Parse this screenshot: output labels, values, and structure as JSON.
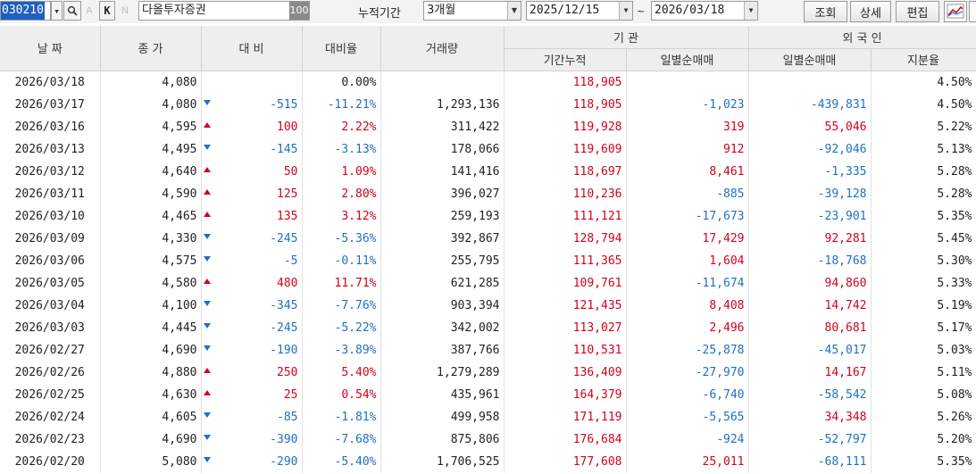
{
  "toolbar": {
    "code": "030210",
    "letter_a": "A",
    "letter_k": "K",
    "letter_n": "N",
    "company": "다올투자증권",
    "badge": "100",
    "period_label": "누적기간",
    "period_value": "3개월",
    "date_from": "2025/12/15",
    "tilde": "~",
    "date_to": "2026/03/18",
    "btn_query": "조회",
    "btn_detail": "상세",
    "btn_edit": "편집"
  },
  "header": {
    "date": "날  짜",
    "close": "종  가",
    "change": "대  비",
    "change_rate": "대비율",
    "volume": "거래량",
    "inst_group": "기    관",
    "inst_cum": "기간누적",
    "inst_daily": "일별순매매",
    "foreign_group": "외 국 인",
    "foreign_daily": "일별순매매",
    "foreign_ratio": "지분율"
  },
  "colors": {
    "up": "#d0021b",
    "down": "#1f6fc5",
    "header_bg": "#eeeeee"
  },
  "rows": [
    {
      "date": "2026/03/18",
      "close": "4,080",
      "dir": "none",
      "change": "",
      "rate": "0.00%",
      "volume": "",
      "inst_cum": "118,905",
      "inst_daily": "",
      "f_daily": "",
      "f_ratio": "4.50%"
    },
    {
      "date": "2026/03/17",
      "close": "4,080",
      "dir": "down",
      "change": "-515",
      "rate": "-11.21%",
      "volume": "1,293,136",
      "inst_cum": "118,905",
      "inst_daily": "-1,023",
      "f_daily": "-439,831",
      "f_ratio": "4.50%"
    },
    {
      "date": "2026/03/16",
      "close": "4,595",
      "dir": "up",
      "change": "100",
      "rate": "2.22%",
      "volume": "311,422",
      "inst_cum": "119,928",
      "inst_daily": "319",
      "f_daily": "55,046",
      "f_ratio": "5.22%"
    },
    {
      "date": "2026/03/13",
      "close": "4,495",
      "dir": "down",
      "change": "-145",
      "rate": "-3.13%",
      "volume": "178,066",
      "inst_cum": "119,609",
      "inst_daily": "912",
      "f_daily": "-92,046",
      "f_ratio": "5.13%"
    },
    {
      "date": "2026/03/12",
      "close": "4,640",
      "dir": "up",
      "change": "50",
      "rate": "1.09%",
      "volume": "141,416",
      "inst_cum": "118,697",
      "inst_daily": "8,461",
      "f_daily": "-1,335",
      "f_ratio": "5.28%"
    },
    {
      "date": "2026/03/11",
      "close": "4,590",
      "dir": "up",
      "change": "125",
      "rate": "2.80%",
      "volume": "396,027",
      "inst_cum": "110,236",
      "inst_daily": "-885",
      "f_daily": "-39,128",
      "f_ratio": "5.28%"
    },
    {
      "date": "2026/03/10",
      "close": "4,465",
      "dir": "up",
      "change": "135",
      "rate": "3.12%",
      "volume": "259,193",
      "inst_cum": "111,121",
      "inst_daily": "-17,673",
      "f_daily": "-23,901",
      "f_ratio": "5.35%"
    },
    {
      "date": "2026/03/09",
      "close": "4,330",
      "dir": "down",
      "change": "-245",
      "rate": "-5.36%",
      "volume": "392,867",
      "inst_cum": "128,794",
      "inst_daily": "17,429",
      "f_daily": "92,281",
      "f_ratio": "5.45%"
    },
    {
      "date": "2026/03/06",
      "close": "4,575",
      "dir": "down",
      "change": "-5",
      "rate": "-0.11%",
      "volume": "255,795",
      "inst_cum": "111,365",
      "inst_daily": "1,604",
      "f_daily": "-18,768",
      "f_ratio": "5.30%"
    },
    {
      "date": "2026/03/05",
      "close": "4,580",
      "dir": "up",
      "change": "480",
      "rate": "11.71%",
      "volume": "621,285",
      "inst_cum": "109,761",
      "inst_daily": "-11,674",
      "f_daily": "94,860",
      "f_ratio": "5.33%"
    },
    {
      "date": "2026/03/04",
      "close": "4,100",
      "dir": "down",
      "change": "-345",
      "rate": "-7.76%",
      "volume": "903,394",
      "inst_cum": "121,435",
      "inst_daily": "8,408",
      "f_daily": "14,742",
      "f_ratio": "5.19%"
    },
    {
      "date": "2026/03/03",
      "close": "4,445",
      "dir": "down",
      "change": "-245",
      "rate": "-5.22%",
      "volume": "342,002",
      "inst_cum": "113,027",
      "inst_daily": "2,496",
      "f_daily": "80,681",
      "f_ratio": "5.17%"
    },
    {
      "date": "2026/02/27",
      "close": "4,690",
      "dir": "down",
      "change": "-190",
      "rate": "-3.89%",
      "volume": "387,766",
      "inst_cum": "110,531",
      "inst_daily": "-25,878",
      "f_daily": "-45,017",
      "f_ratio": "5.03%"
    },
    {
      "date": "2026/02/26",
      "close": "4,880",
      "dir": "up",
      "change": "250",
      "rate": "5.40%",
      "volume": "1,279,289",
      "inst_cum": "136,409",
      "inst_daily": "-27,970",
      "f_daily": "14,167",
      "f_ratio": "5.11%"
    },
    {
      "date": "2026/02/25",
      "close": "4,630",
      "dir": "up",
      "change": "25",
      "rate": "0.54%",
      "volume": "435,961",
      "inst_cum": "164,379",
      "inst_daily": "-6,740",
      "f_daily": "-58,542",
      "f_ratio": "5.08%"
    },
    {
      "date": "2026/02/24",
      "close": "4,605",
      "dir": "down",
      "change": "-85",
      "rate": "-1.81%",
      "volume": "499,958",
      "inst_cum": "171,119",
      "inst_daily": "-5,565",
      "f_daily": "34,348",
      "f_ratio": "5.26%"
    },
    {
      "date": "2026/02/23",
      "close": "4,690",
      "dir": "down",
      "change": "-390",
      "rate": "-7.68%",
      "volume": "875,806",
      "inst_cum": "176,684",
      "inst_daily": "-924",
      "f_daily": "-52,797",
      "f_ratio": "5.20%"
    },
    {
      "date": "2026/02/20",
      "close": "5,080",
      "dir": "down",
      "change": "-290",
      "rate": "-5.40%",
      "volume": "1,706,525",
      "inst_cum": "177,608",
      "inst_daily": "25,011",
      "f_daily": "-68,111",
      "f_ratio": "5.35%"
    }
  ]
}
